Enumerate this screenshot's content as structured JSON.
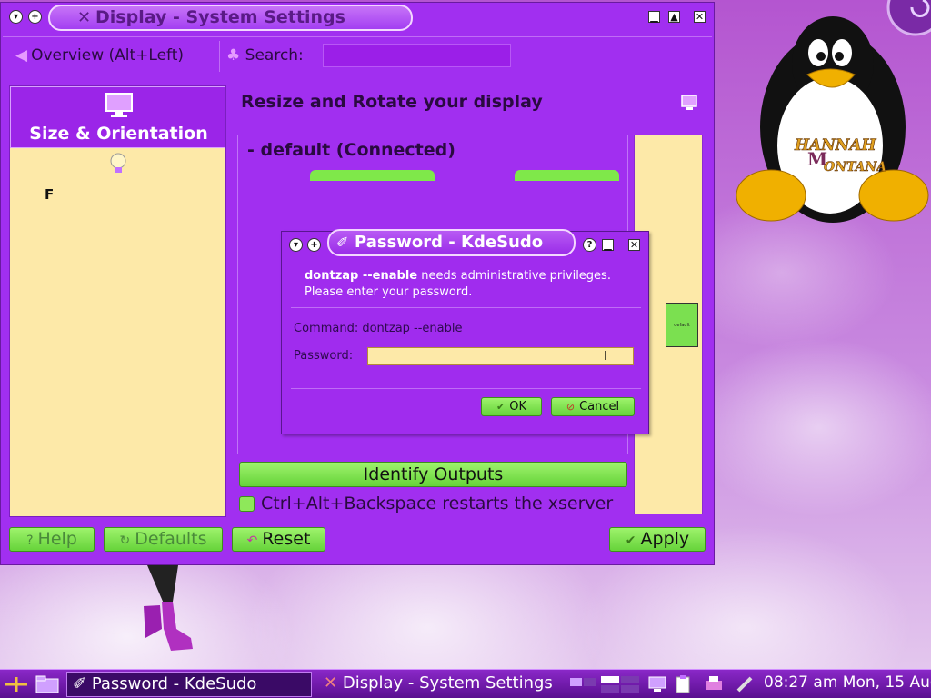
{
  "main_window": {
    "title": "Display - System Settings",
    "toolbar": {
      "overview_label": "Overview (Alt+Left)",
      "search_label": "Search:",
      "search_value": ""
    },
    "sidebar": {
      "selected_label": "Size & Orientation",
      "stub_text": "F"
    },
    "content": {
      "title": "Resize and Rotate your display",
      "output_name": "- default (Connected)",
      "preview_label": "default",
      "identify_label": "Identify Outputs",
      "xserver_checkbox": {
        "label": "Ctrl+Alt+Backspace restarts the xserver",
        "checked": false
      }
    },
    "buttons": {
      "help": "Help",
      "defaults": "Defaults",
      "reset": "Reset",
      "apply": "Apply"
    }
  },
  "password_dialog": {
    "title": "Password - KdeSudo",
    "message_bold": "dontzap --enable",
    "message_rest": " needs administrative privileges.",
    "message_line2": "Please enter your password.",
    "command_text": "Command: dontzap --enable",
    "password_label": "Password:",
    "password_value": "",
    "ok_label": "OK",
    "cancel_label": "Cancel"
  },
  "taskbar": {
    "tasks": [
      {
        "label": "Password - KdeSudo",
        "active": true
      },
      {
        "label": "Display - System Settings",
        "active": false
      }
    ],
    "clock": "08:27 am  Mon, 15 Aug"
  },
  "colors": {
    "window_bg": "#a12ff0",
    "panel_bg": "#fde9a8",
    "button_green": "#7fe84a"
  }
}
